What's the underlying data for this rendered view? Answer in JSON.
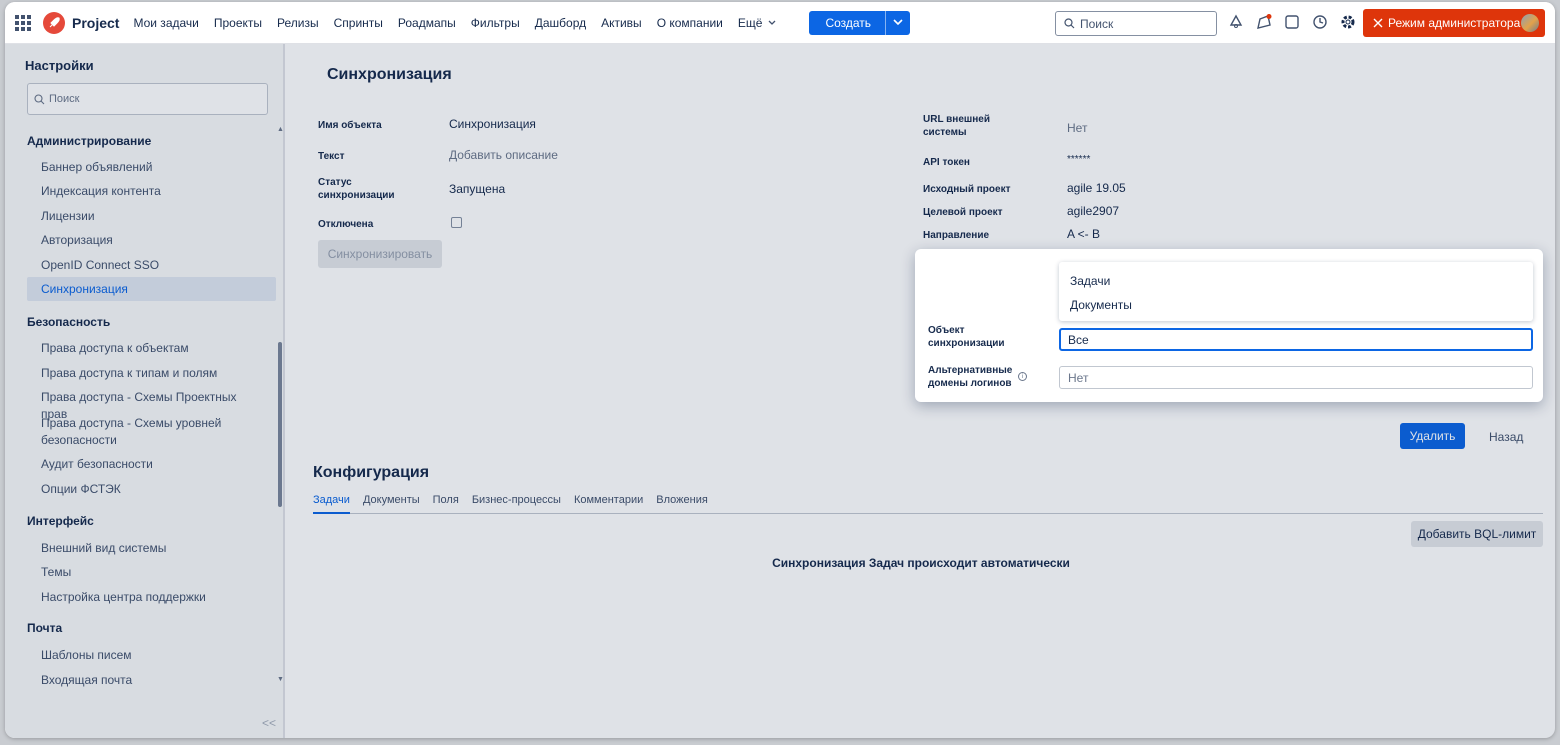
{
  "header": {
    "product": "Project",
    "nav": [
      "Мои задачи",
      "Проекты",
      "Релизы",
      "Спринты",
      "Роадмапы",
      "Фильтры",
      "Дашборд",
      "Активы",
      "О компании"
    ],
    "more": "Ещё",
    "create": "Создать",
    "search_placeholder": "Поиск",
    "admin_mode": "Режим администратора"
  },
  "sidebar": {
    "title": "Настройки",
    "search_placeholder": "Поиск",
    "groups": {
      "admin": {
        "label": "Администрирование",
        "items": [
          "Баннер объявлений",
          "Индексация контента",
          "Лицензии",
          "Авторизация",
          "OpenID Connect SSO",
          "Синхронизация"
        ]
      },
      "security": {
        "label": "Безопасность",
        "items": [
          "Права доступа к объектам",
          "Права доступа к типам и полям",
          "Права доступа - Схемы Проектных прав",
          "Права доступа - Схемы уровней безопасности",
          "Аудит безопасности",
          "Опции ФСТЭК"
        ]
      },
      "interface": {
        "label": "Интерфейс",
        "items": [
          "Внешний вид системы",
          "Темы",
          "Настройка центра поддержки"
        ]
      },
      "mail": {
        "label": "Почта",
        "items": [
          "Шаблоны писем",
          "Входящая почта"
        ]
      }
    },
    "collapse": "<<"
  },
  "page": {
    "title": "Синхронизация",
    "left_fields": {
      "object_name_label": "Имя объекта",
      "object_name_value": "Синхронизация",
      "text_label": "Текст",
      "text_value": "Добавить описание",
      "status_label": "Статус синхронизации",
      "status_value": "Запущена",
      "disabled_label": "Отключена"
    },
    "sync_button": "Синхронизировать",
    "right_fields": {
      "url_label": "URL внешней системы",
      "url_value": "Нет",
      "token_label": "API токен",
      "token_value": "******",
      "source_label": "Исходный проект",
      "source_value": "agile 19.05",
      "target_label": "Целевой проект",
      "target_value": "agile2907",
      "direction_label": "Направление",
      "direction_value": "A <- B"
    },
    "popup": {
      "options": [
        "Задачи",
        "Документы"
      ],
      "sync_object_label": "Объект синхронизации",
      "sync_object_value": "Все",
      "alt_domains_label": "Альтернативные домены логинов",
      "alt_domains_value": "Нет"
    },
    "delete_button": "Удалить",
    "back_button": "Назад"
  },
  "config": {
    "title": "Конфигурация",
    "tabs": [
      "Задачи",
      "Документы",
      "Поля",
      "Бизнес-процессы",
      "Комментарии",
      "Вложения"
    ],
    "bql_button": "Добавить BQL-лимит",
    "message": "Синхронизация Задач происходит автоматически"
  },
  "colors": {
    "accent": "#0c66e4",
    "admin": "#de350b",
    "logo": "#e5493a"
  }
}
